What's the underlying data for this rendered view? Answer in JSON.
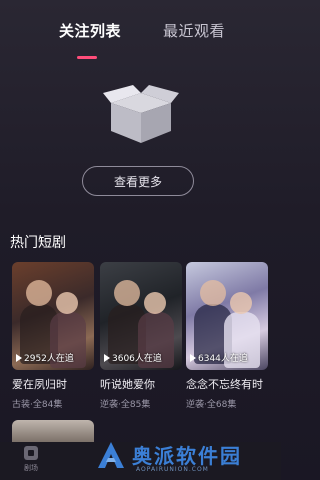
{
  "tabs": [
    {
      "label": "关注列表",
      "active": true
    },
    {
      "label": "最近观看",
      "active": false
    }
  ],
  "accent_color": "#ff4d7a",
  "empty_state": {
    "icon": "empty-box-icon",
    "button_label": "查看更多"
  },
  "hot_section": {
    "title": "热门短剧",
    "items": [
      {
        "title": "爱在夙归时",
        "plays": "2952人在追",
        "meta": "古装·全84集"
      },
      {
        "title": "听说她爱你",
        "plays": "3606人在追",
        "meta": "逆袭·全85集"
      },
      {
        "title": "念念不忘终有时",
        "plays": "6344人在追",
        "meta": "逆袭·全68集"
      }
    ]
  },
  "bottom_nav": {
    "items": [
      {
        "label": "剧场",
        "icon": "theater-icon"
      }
    ]
  },
  "watermark": {
    "text": "奥派软件园",
    "sub": "AOPAIRUNION.COM"
  }
}
